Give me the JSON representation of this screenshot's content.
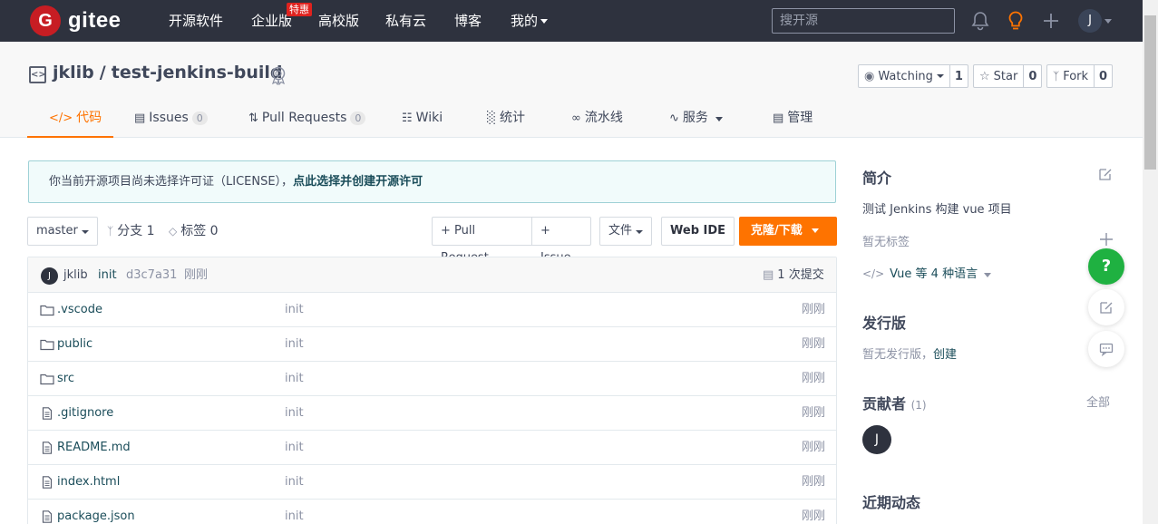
{
  "nav": {
    "logo_letter": "G",
    "logo_text": "gitee",
    "items": [
      "开源软件",
      "企业版",
      "高校版",
      "私有云",
      "博客",
      "我的"
    ],
    "badge": "特惠",
    "search_placeholder": "搜开源",
    "user_initial": "J"
  },
  "repo": {
    "owner": "jklib",
    "separator": "/",
    "name": "test-jenkins-build",
    "watch": {
      "label": "Watching",
      "count": "1"
    },
    "star": {
      "label": "Star",
      "count": "0"
    },
    "fork": {
      "label": "Fork",
      "count": "0"
    }
  },
  "tabs": [
    {
      "label": "代码",
      "icon": "code-icon"
    },
    {
      "label": "Issues",
      "count": "0",
      "icon": "issues-icon"
    },
    {
      "label": "Pull Requests",
      "count": "0",
      "icon": "pull-request-icon"
    },
    {
      "label": "Wiki",
      "icon": "wiki-icon"
    },
    {
      "label": "统计",
      "icon": "stats-icon"
    },
    {
      "label": "流水线",
      "icon": "pipeline-icon"
    },
    {
      "label": "服务",
      "icon": "service-icon"
    },
    {
      "label": "管理",
      "icon": "manage-icon"
    }
  ],
  "license": {
    "text": "你当前开源项目尚未选择许可证（LICENSE），",
    "link": "点此选择并创建开源许可"
  },
  "toolbar": {
    "branch": "master",
    "branches": "分支 1",
    "tags": "标签 0",
    "pull_request": "+ Pull Request",
    "issue": "+ Issue",
    "file": "文件",
    "web_ide": "Web IDE",
    "clone": "克隆/下载"
  },
  "commit": {
    "avatar": "J",
    "author": "jklib",
    "message": "init",
    "hash": "d3c7a31",
    "time": "刚刚",
    "count": "1 次提交"
  },
  "files": [
    {
      "name": ".vscode",
      "type": "folder",
      "message": "init",
      "time": "刚刚"
    },
    {
      "name": "public",
      "type": "folder",
      "message": "init",
      "time": "刚刚"
    },
    {
      "name": "src",
      "type": "folder",
      "message": "init",
      "time": "刚刚"
    },
    {
      "name": ".gitignore",
      "type": "file",
      "message": "init",
      "time": "刚刚"
    },
    {
      "name": "README.md",
      "type": "file",
      "message": "init",
      "time": "刚刚"
    },
    {
      "name": "index.html",
      "type": "file",
      "message": "init",
      "time": "刚刚"
    },
    {
      "name": "package.json",
      "type": "file",
      "message": "init",
      "time": "刚刚"
    }
  ],
  "sidebar": {
    "intro_title": "简介",
    "description": "测试 Jenkins 构建 vue 项目",
    "no_tags": "暂无标签",
    "languages": "Vue 等 4 种语言",
    "release_title": "发行版",
    "no_release": "暂无发行版，",
    "create": "创建",
    "contributors_title": "贡献者",
    "contributors_count": "(1)",
    "all": "全部",
    "contributor_initial": "J",
    "activity_title": "近期动态"
  },
  "floating": {
    "help": "?"
  },
  "colors": {
    "accent": "#fe7300",
    "nav_bg": "#2e323e",
    "help": "#1fb141"
  }
}
